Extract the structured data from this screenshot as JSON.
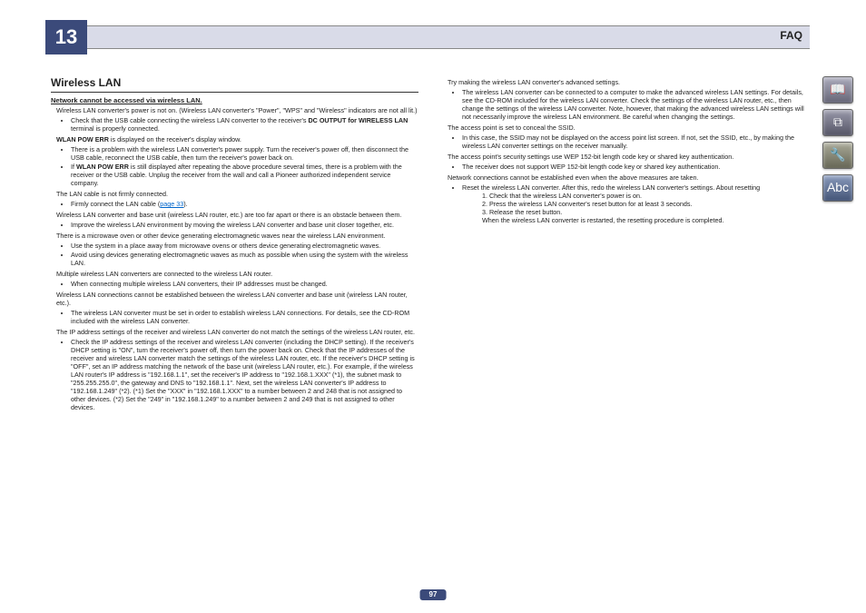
{
  "header": {
    "chapter": "13",
    "title": "FAQ"
  },
  "pageNumber": "97",
  "section": {
    "heading": "Wireless LAN",
    "topic1": "Network cannot be accessed via wireless LAN.",
    "col1": {
      "p1": "Wireless LAN converter's power is not on. (Wireless LAN converter's \"Power\", \"WPS\" and \"Wireless\" indicators are not all lit.)",
      "b1a_pre": "Check that the USB cable connecting the wireless LAN converter to the receiver's ",
      "b1a_bold": "DC OUTPUT for WIRELESS LAN",
      "b1a_post": " terminal is properly connected.",
      "p2_pre": "",
      "p2_bold": "WLAN POW ERR",
      "p2_post": " is displayed on the receiver's display window.",
      "b2a": "There is a problem with the wireless LAN converter's power supply. Turn the receiver's power off, then disconnect the USB cable, reconnect the USB cable, then turn the receiver's power back on.",
      "b2b_pre": "If ",
      "b2b_bold": "WLAN POW ERR",
      "b2b_post": " is still displayed after repeating the above procedure several times, there is a problem with the receiver or the USB cable. Unplug the receiver from the wall and call a Pioneer authorized independent service company.",
      "p3": "The LAN cable is not firmly connected.",
      "b3a": "Firmly connect the LAN cable (",
      "b3a_link": "page 33",
      "b3a_end": ").",
      "p4": "Wireless LAN converter and base unit (wireless LAN router, etc.) are too far apart or there is an obstacle between them.",
      "b4a": "Improve the wireless LAN environment by moving the wireless LAN converter and base unit closer together, etc.",
      "p5": "There is a microwave oven or other device generating electromagnetic waves near the wireless LAN environment.",
      "b5a": "Use the system in a place away from microwave ovens or others device generating electromagnetic waves.",
      "b5b": "Avoid using devices generating electromagnetic waves as much as possible when using the system with the wireless LAN.",
      "p6": "Multiple wireless LAN converters are connected to the wireless LAN router.",
      "b6a": "When connecting multiple wireless LAN converters, their IP addresses must be changed.",
      "p7": "Wireless LAN connections cannot be established between the wireless LAN converter and base unit (wireless LAN router, etc.).",
      "b7a": "The wireless LAN converter must be set in order to establish wireless LAN connections. For details, see the CD-ROM included with the wireless LAN converter.",
      "p8": "The IP address settings of the receiver and wireless LAN converter do not match the settings of the wireless LAN router, etc.",
      "b8a": "Check the IP address settings of the receiver and wireless LAN converter (including the DHCP setting). If the receiver's DHCP setting is \"ON\", turn the receiver's power off, then turn the power back on. Check that the IP addresses of the receiver and wireless LAN converter match the settings of the wireless LAN router, etc. If the receiver's DHCP setting is \"OFF\", set an IP address matching the network of the base unit (wireless LAN router, etc.). For example, if the wireless LAN router's IP address is \"192.168.1.1\", set the receiver's IP address to \"192.168.1.XXX\" (*1), the subnet mask to \"255.255.255.0\", the gateway and DNS to \"192.168.1.1\". Next, set the wireless LAN converter's IP address to \"192.168.1.249\" (*2). (*1) Set the \"XXX\" in \"192.168.1.XXX\" to a number between 2 and 248 that is not assigned to other devices. (*2) Set the \"249\" in \"192.168.1.249\" to a number between 2 and 249 that is not assigned to other devices."
    },
    "col2": {
      "p1": "Try making the wireless LAN converter's advanced settings.",
      "b1a": "The wireless LAN converter can be connected to a computer to make the advanced wireless LAN settings. For details, see the CD-ROM included for the wireless LAN converter. Check the settings of the wireless LAN router, etc., then change the settings of the wireless LAN converter. Note, however, that making the advanced wireless LAN settings will not necessarily improve the wireless LAN environment. Be careful when changing the settings.",
      "p2": "The access point is set to conceal the SSID.",
      "b2a": "In this case, the SSID may not be displayed on the access point list screen. If not, set the SSID, etc., by making the wireless LAN converter settings on the receiver manually.",
      "p3": "The access point's security settings use WEP 152-bit length code key or shared key authentication.",
      "b3a": "The receiver does not support WEP 152-bit length code key or shared key authentication.",
      "p4": "Network connections cannot be established even when the above measures are taken.",
      "b4a": "Reset the wireless LAN converter. After this, redo the wireless LAN converter's settings. About resetting",
      "b4a_1": "1. Check that the wireless LAN converter's power is on.",
      "b4a_2": "2. Press the wireless LAN converter's reset button for at least 3 seconds.",
      "b4a_3": "3. Release the reset button.",
      "b4a_4": "When the wireless LAN converter is restarted, the resetting procedure is completed."
    }
  },
  "sideIcons": [
    "book-icon",
    "device-icon",
    "wrench-icon",
    "glossary-icon"
  ]
}
